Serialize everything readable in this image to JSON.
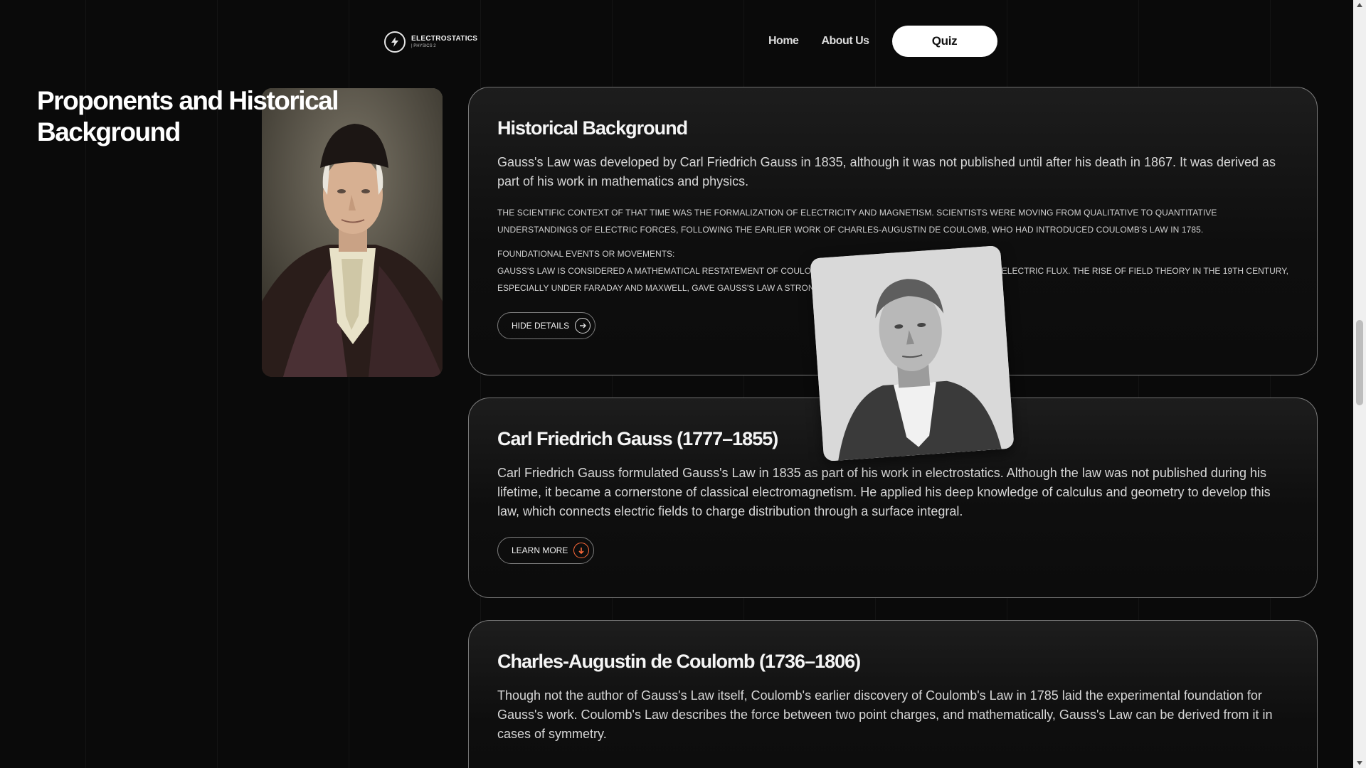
{
  "header": {
    "logo_title": "ELECTROSTATICS",
    "logo_sub": "| PHYSICS 2",
    "nav": {
      "home": "Home",
      "about": "About Us",
      "quiz": "Quiz"
    }
  },
  "section": {
    "title": "Proponents and Historical Background"
  },
  "cards": [
    {
      "title": "Historical Background",
      "lead": "Gauss's Law was developed by Carl Friedrich Gauss in 1835, although it was not published until after his death in 1867. It was derived as part of his work in mathematics and physics.",
      "detail1": "THE SCIENTIFIC CONTEXT OF THAT TIME WAS THE FORMALIZATION OF ELECTRICITY AND MAGNETISM. SCIENTISTS WERE MOVING FROM QUALITATIVE TO QUANTITATIVE UNDERSTANDINGS OF ELECTRIC FORCES, FOLLOWING THE EARLIER WORK OF CHARLES-AUGUSTIN DE COULOMB, WHO HAD INTRODUCED COULOMB'S LAW IN 1785.",
      "detail2_heading": "FOUNDATIONAL EVENTS OR MOVEMENTS:",
      "detail2_a": "GAUSS'S LAW IS CONSIDERED A MATHEMATICAL RESTATEMENT OF COULOM",
      "detail2_b": "ELECTRIC FLUX. THE RISE OF FIELD THEORY IN THE 19TH CENTURY,",
      "detail2_c": "ESPECIALLY UNDER FARADAY AND MAXWELL, GAVE GAUSS'S LAW A STRONG",
      "button": "HIDE DETAILS"
    },
    {
      "title": "Carl Friedrich Gauss (1777–1855)",
      "lead": "Carl Friedrich Gauss formulated Gauss's Law in 1835 as part of his work in electrostatics. Although the law was not published during his lifetime, it became a cornerstone of classical electromagnetism. He applied his deep knowledge of calculus and geometry to develop this law, which connects electric fields to charge distribution through a surface integral.",
      "button": "LEARN MORE"
    },
    {
      "title": "Charles-Augustin de Coulomb (1736–1806)",
      "lead": "Though not the author of Gauss's Law itself, Coulomb's earlier discovery of Coulomb's Law in 1785 laid the experimental foundation for Gauss's work. Coulomb's Law describes the force between two point charges, and mathematically, Gauss's Law can be derived from it in cases of symmetry."
    }
  ],
  "colors": {
    "background": "#0a0a0a",
    "accent_orange": "#ff6a3a",
    "text": "#e8e8e8"
  }
}
